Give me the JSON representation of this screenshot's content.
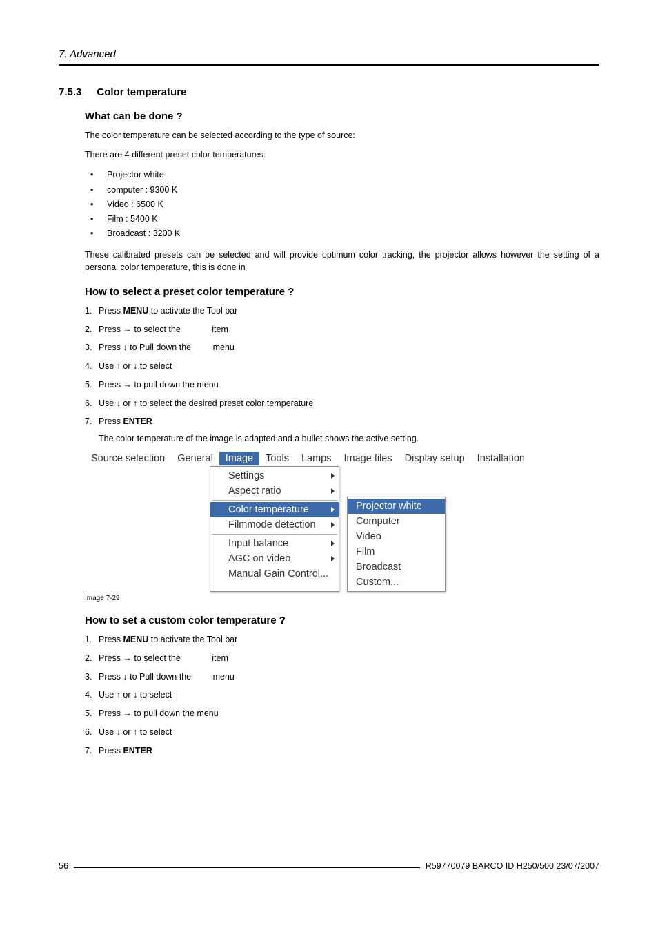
{
  "chapter": "7. Advanced",
  "section": {
    "number": "7.5.3",
    "title": "Color temperature"
  },
  "sub1": {
    "heading": "What can be done ?",
    "p1": "The color temperature can be selected according to the type of source:",
    "p2": "There are 4 different preset color temperatures:",
    "presets": [
      "Projector white",
      "computer :  9300 K",
      "Video :  6500 K",
      "Film :  5400 K",
      "Broadcast :  3200 K"
    ],
    "p3": "These calibrated presets can be selected and will provide optimum color tracking, the projector allows however the setting of a personal color temperature, this is done in"
  },
  "sub2": {
    "heading": "How to select a preset color temperature ?",
    "steps": {
      "s1_a": "Press ",
      "s1_b": "MENU",
      "s1_c": " to activate the Tool bar",
      "s2_a": "Press → to select the ",
      "s2_b": "item",
      "s3_a": "Press ↓ to Pull down the ",
      "s3_b": "menu",
      "s4": "Use ↑ or ↓ to select",
      "s5": "Press → to pull down the menu",
      "s6": "Use ↓ or ↑ to select the desired preset color temperature",
      "s7_a": "Press ",
      "s7_b": "ENTER",
      "note": "The color temperature of the image is adapted and a bullet shows the active setting."
    }
  },
  "ui": {
    "menubar": [
      "Source selection",
      "General",
      "Image",
      "Tools",
      "Lamps",
      "Image files",
      "Display setup",
      "Installation"
    ],
    "menubar_active": "Image",
    "drop1": [
      {
        "label": "Settings",
        "arrow": true
      },
      {
        "label": "Aspect ratio",
        "arrow": true
      },
      {
        "divider": true
      },
      {
        "label": "Color temperature",
        "arrow": true,
        "selected": true
      },
      {
        "label": "Filmmode detection",
        "arrow": true
      },
      {
        "divider": true
      },
      {
        "label": "Input balance",
        "arrow": true
      },
      {
        "label": "AGC on video",
        "arrow": true
      },
      {
        "label": "Manual Gain Control...",
        "arrow": false
      }
    ],
    "drop2": [
      {
        "label": "Projector white",
        "selected": true
      },
      {
        "label": "Computer"
      },
      {
        "label": "Video"
      },
      {
        "label": "Film"
      },
      {
        "label": "Broadcast"
      },
      {
        "label": "Custom..."
      }
    ]
  },
  "img_caption": "Image 7-29",
  "sub3": {
    "heading": "How to set a custom color temperature ?",
    "steps": {
      "s1_a": "Press ",
      "s1_b": "MENU",
      "s1_c": " to activate the Tool bar",
      "s2_a": "Press → to select the ",
      "s2_b": "item",
      "s3_a": "Press ↓ to Pull down the ",
      "s3_b": "menu",
      "s4": "Use ↑ or ↓ to select",
      "s5": "Press → to pull down the menu",
      "s6": "Use ↓ or ↑ to select",
      "s7_a": "Press ",
      "s7_b": "ENTER"
    }
  },
  "footer": {
    "page": "56",
    "doc": "R59770079  BARCO ID H250/500  23/07/2007"
  }
}
